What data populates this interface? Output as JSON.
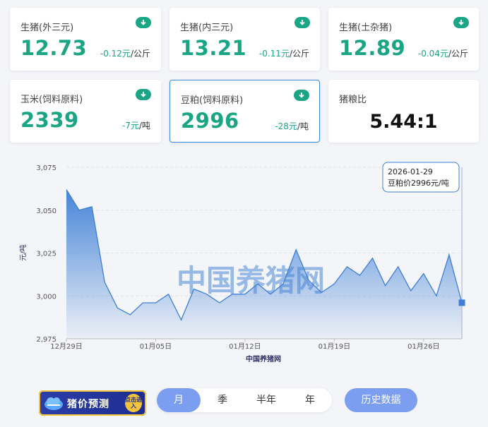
{
  "cards": [
    {
      "name": "生猪(外三元)",
      "price": "12.73",
      "change": "-0.12元",
      "unit": "/公斤"
    },
    {
      "name": "生猪(内三元)",
      "price": "13.21",
      "change": "-0.11元",
      "unit": "/公斤"
    },
    {
      "name": "生猪(土杂猪)",
      "price": "12.89",
      "change": "-0.04元",
      "unit": "/公斤"
    },
    {
      "name": "玉米(饲料原料)",
      "price": "2339",
      "change": "-7元",
      "unit": "/吨"
    },
    {
      "name": "豆粕(饲料原料)",
      "price": "2996",
      "change": "-28元",
      "unit": "/吨"
    },
    {
      "name": "猪粮比",
      "ratio": "5.44:1"
    }
  ],
  "icons": {
    "download": "download-arrow-icon",
    "cloud": "cloud-icon"
  },
  "colors": {
    "accent": "#1aa685",
    "line": "#3d7fd6",
    "button": "#7c9ef1"
  },
  "chart_data": {
    "type": "area",
    "ylabel": "元/吨",
    "xlabel": "中国养猪网",
    "watermark": "中国养猪网",
    "ylim": [
      2975,
      3075
    ],
    "yticks": [
      "2,975",
      "3,000",
      "3,025",
      "3,050",
      "3,075"
    ],
    "ytick_values": [
      2975,
      3000,
      3025,
      3050,
      3075
    ],
    "xticks": [
      "12月29日",
      "01月05日",
      "01月12日",
      "01月19日",
      "01月26日"
    ],
    "xtick_dates": [
      "2025-12-29",
      "2026-01-05",
      "2026-01-12",
      "2026-01-19",
      "2026-01-26"
    ],
    "series": [
      {
        "values": [
          [
            "2025-12-29",
            3062
          ],
          [
            "2025-12-30",
            3050
          ],
          [
            "2025-12-31",
            3052
          ],
          [
            "2026-01-01",
            3008
          ],
          [
            "2026-01-02",
            2993
          ],
          [
            "2026-01-03",
            2989
          ],
          [
            "2026-01-04",
            2996
          ],
          [
            "2026-01-05",
            2996
          ],
          [
            "2026-01-06",
            3001
          ],
          [
            "2026-01-07",
            2986
          ],
          [
            "2026-01-08",
            3004
          ],
          [
            "2026-01-09",
            3001
          ],
          [
            "2026-01-10",
            2996
          ],
          [
            "2026-01-11",
            3001
          ],
          [
            "2026-01-12",
            3001
          ],
          [
            "2026-01-13",
            3007
          ],
          [
            "2026-01-14",
            3001
          ],
          [
            "2026-01-15",
            3007
          ],
          [
            "2026-01-16",
            3027
          ],
          [
            "2026-01-17",
            3009
          ],
          [
            "2026-01-18",
            3002
          ],
          [
            "2026-01-19",
            3007
          ],
          [
            "2026-01-20",
            3017
          ],
          [
            "2026-01-21",
            3012
          ],
          [
            "2026-01-22",
            3022
          ],
          [
            "2026-01-23",
            3006
          ],
          [
            "2026-01-24",
            3017
          ],
          [
            "2026-01-25",
            3003
          ],
          [
            "2026-01-26",
            3013
          ],
          [
            "2026-01-27",
            3000
          ],
          [
            "2026-01-28",
            3024
          ],
          [
            "2026-01-29",
            2996
          ]
        ]
      }
    ],
    "tooltip": {
      "date": "2026-01-29",
      "label": "豆粕价",
      "value": "2996",
      "unit": "元/吨"
    },
    "grid": true
  },
  "bottom": {
    "promo": "猪价预测",
    "promo_enter": "点击进入",
    "tabs": [
      "月",
      "季",
      "半年",
      "年"
    ],
    "active_tab": "月",
    "history": "历史数据"
  }
}
